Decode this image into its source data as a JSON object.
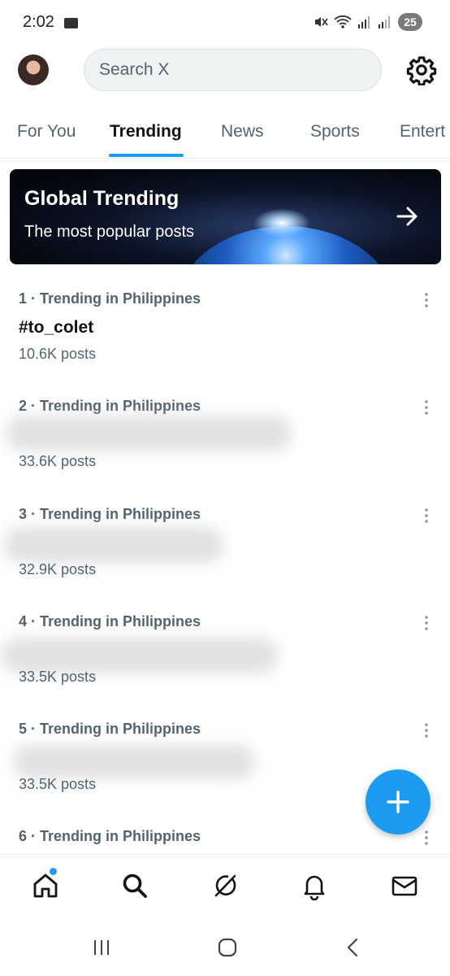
{
  "status_bar": {
    "time": "2:02",
    "battery": "25",
    "icons": [
      "mail-icon",
      "mute-icon",
      "wifi-icon",
      "signal-icon",
      "signal-icon"
    ]
  },
  "header": {
    "search_placeholder": "Search X",
    "settings_icon": "gear-icon"
  },
  "tabs": [
    {
      "label": "For You",
      "active": false
    },
    {
      "label": "Trending",
      "active": true
    },
    {
      "label": "News",
      "active": false
    },
    {
      "label": "Sports",
      "active": false
    },
    {
      "label": "Entert",
      "active": false
    }
  ],
  "banner": {
    "title": "Global Trending",
    "subtitle": "The most popular posts"
  },
  "trends": [
    {
      "meta": "1 · Trending in Philippines",
      "name": "#to_colet",
      "count": "10.6K posts"
    },
    {
      "meta": "2 · Trending in Philippines",
      "name": "",
      "count": "33.6K posts"
    },
    {
      "meta": "3 · Trending in Philippines",
      "name": "",
      "count": "32.9K posts"
    },
    {
      "meta": "4 · Trending in Philippines",
      "name": "",
      "count": "33.5K posts"
    },
    {
      "meta": "5 · Trending in Philippines",
      "name": "",
      "count": "33.5K posts"
    },
    {
      "meta": "6 · Trending in Philippines",
      "name": "",
      "count": ""
    }
  ],
  "bottom_nav": [
    "home-icon",
    "search-icon",
    "grok-icon",
    "bell-icon",
    "mail-icon"
  ],
  "colors": {
    "accent": "#1d9bf0",
    "text": "#0f1419",
    "secondary": "#536471"
  }
}
